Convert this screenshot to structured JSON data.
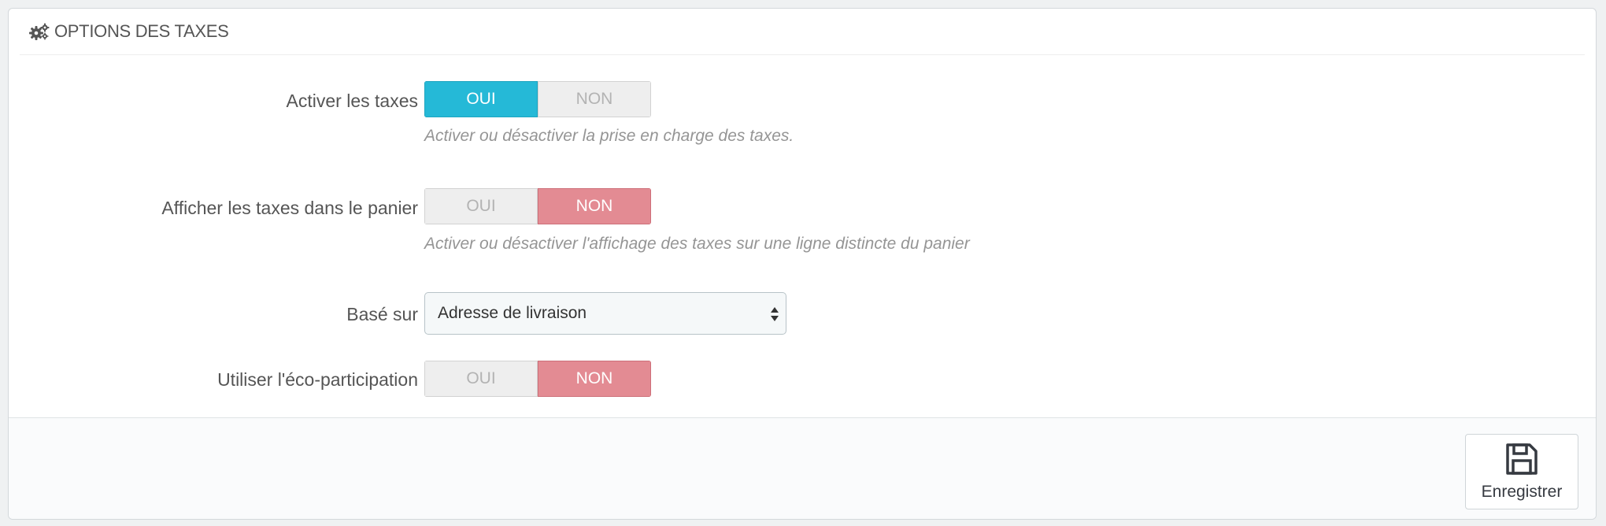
{
  "panel": {
    "title": "OPTIONS DES TAXES",
    "title_icon": "cogs-icon"
  },
  "fields": [
    {
      "label": "Activer les taxes",
      "type": "switch",
      "yes_label": "OUI",
      "no_label": "NON",
      "value": "yes",
      "help": "Activer ou désactiver la prise en charge des taxes."
    },
    {
      "label": "Afficher les taxes dans le panier",
      "type": "switch",
      "yes_label": "OUI",
      "no_label": "NON",
      "value": "no",
      "help": "Activer ou désactiver l'affichage des taxes sur une ligne distincte du panier"
    },
    {
      "label": "Basé sur",
      "type": "select",
      "selected": "Adresse de livraison"
    },
    {
      "label": "Utiliser l'éco-participation",
      "type": "switch",
      "yes_label": "OUI",
      "no_label": "NON",
      "value": "no"
    }
  ],
  "footer": {
    "save_label": "Enregistrer",
    "save_icon": "floppy-disk-icon"
  },
  "colors": {
    "switch_yes_active": "#25b9d7",
    "switch_no_active": "#e38b93",
    "inactive": "#eeeeee"
  }
}
